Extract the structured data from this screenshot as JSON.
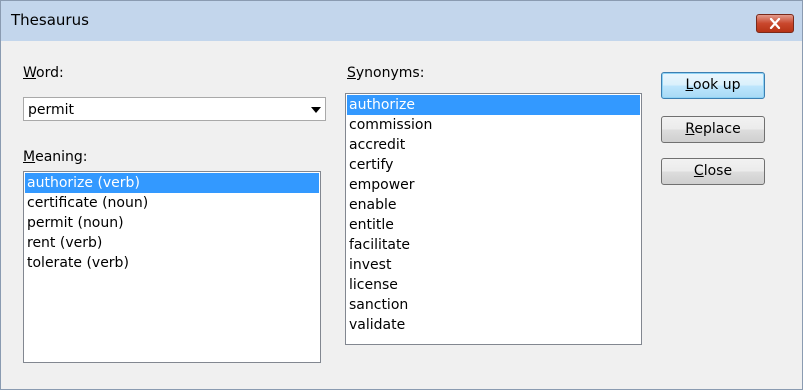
{
  "window": {
    "title": "Thesaurus"
  },
  "word": {
    "label": "Word:",
    "mnemonic": "W",
    "label_rest": "ord:",
    "value": "permit"
  },
  "meaning": {
    "label_mnemonic": "M",
    "label_rest": "eaning:",
    "items": [
      "authorize (verb)",
      "certificate (noun)",
      "permit (noun)",
      "rent (verb)",
      "tolerate (verb)"
    ],
    "selected_index": 0
  },
  "synonyms": {
    "label_mnemonic": "S",
    "label_rest": "ynonyms:",
    "items": [
      "authorize",
      "commission",
      "accredit",
      "certify",
      "empower",
      "enable",
      "entitle",
      "facilitate",
      "invest",
      "license",
      "sanction",
      "validate"
    ],
    "selected_index": 0
  },
  "buttons": {
    "lookup_mnemonic": "L",
    "lookup_rest": "ook up",
    "replace_mnemonic": "R",
    "replace_rest": "eplace",
    "close_mnemonic": "C",
    "close_rest": "lose"
  },
  "icons": {
    "close": "close-icon",
    "dropdown": "chevron-down-icon"
  },
  "colors": {
    "selection": "#3399ff",
    "titlebar": "#c3d6ec",
    "close_button": "#c9472c"
  }
}
